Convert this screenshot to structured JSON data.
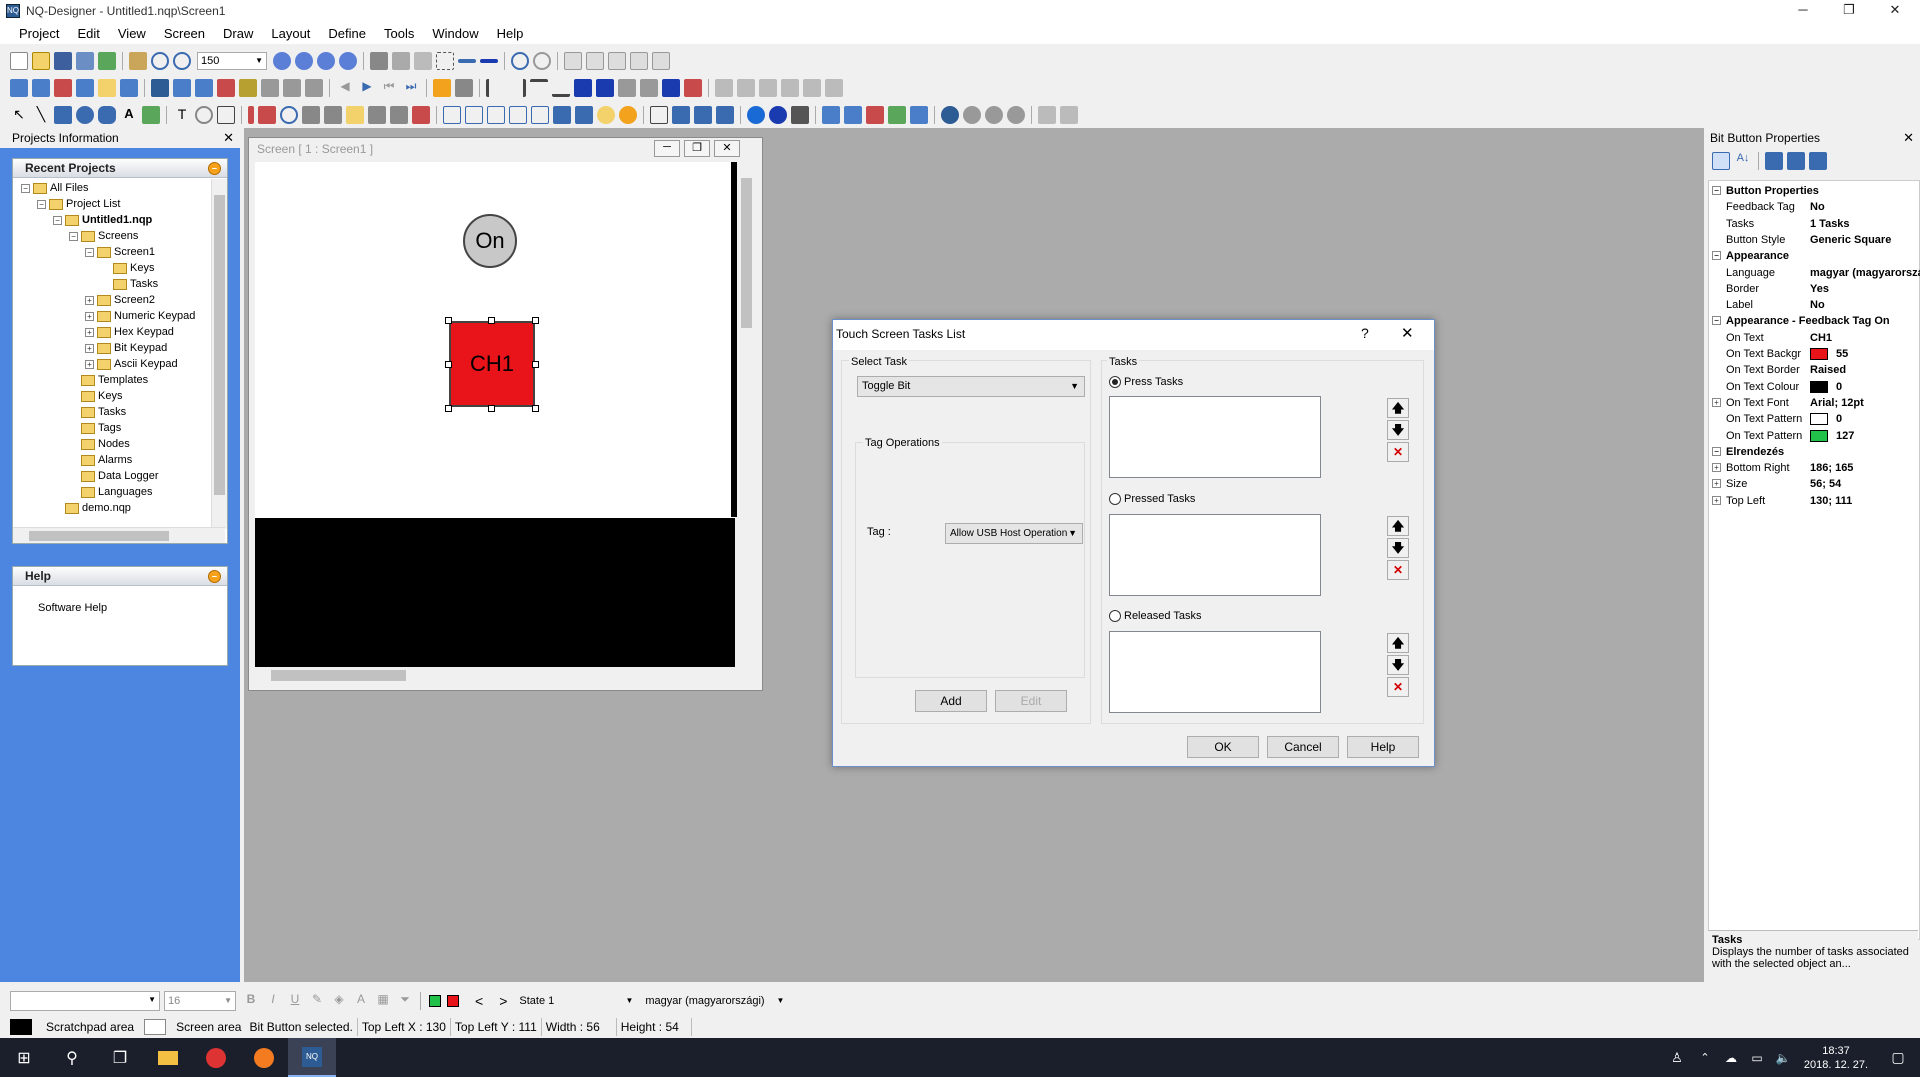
{
  "app": {
    "title": "NQ-Designer - Untitled1.nqp\\Screen1",
    "icon": "nq-app-icon",
    "window_controls": [
      "─",
      "❐",
      "✕"
    ]
  },
  "menu": [
    "Project",
    "Edit",
    "View",
    "Screen",
    "Draw",
    "Layout",
    "Define",
    "Tools",
    "Window",
    "Help"
  ],
  "toolbar1": {
    "zoom_value": "150"
  },
  "left_panel": {
    "title": "Projects Information",
    "recent_title": "Recent Projects",
    "tree": [
      {
        "label": "All Files",
        "level": 0,
        "pm": "⊟",
        "bold": false
      },
      {
        "label": "Project List",
        "level": 1,
        "pm": "⊟",
        "bold": false
      },
      {
        "label": "Untitled1.nqp",
        "level": 2,
        "pm": "⊟",
        "bold": true
      },
      {
        "label": "Screens",
        "level": 3,
        "pm": "⊟",
        "bold": false
      },
      {
        "label": "Screen1",
        "level": 4,
        "pm": "⊟",
        "bold": false
      },
      {
        "label": "Keys",
        "level": 5,
        "pm": "",
        "bold": false
      },
      {
        "label": "Tasks",
        "level": 5,
        "pm": "",
        "bold": false
      },
      {
        "label": "Screen2",
        "level": 4,
        "pm": "⊞",
        "bold": false
      },
      {
        "label": "Numeric Keypad",
        "level": 4,
        "pm": "⊞",
        "bold": false
      },
      {
        "label": "Hex Keypad",
        "level": 4,
        "pm": "⊞",
        "bold": false
      },
      {
        "label": "Bit Keypad",
        "level": 4,
        "pm": "⊞",
        "bold": false
      },
      {
        "label": "Ascii Keypad",
        "level": 4,
        "pm": "⊞",
        "bold": false
      },
      {
        "label": "Templates",
        "level": 3,
        "pm": "",
        "bold": false
      },
      {
        "label": "Keys",
        "level": 3,
        "pm": "",
        "bold": false
      },
      {
        "label": "Tasks",
        "level": 3,
        "pm": "",
        "bold": false
      },
      {
        "label": "Tags",
        "level": 3,
        "pm": "",
        "bold": false
      },
      {
        "label": "Nodes",
        "level": 3,
        "pm": "",
        "bold": false
      },
      {
        "label": "Alarms",
        "level": 3,
        "pm": "",
        "bold": false
      },
      {
        "label": "Data Logger",
        "level": 3,
        "pm": "",
        "bold": false
      },
      {
        "label": "Languages",
        "level": 3,
        "pm": "",
        "bold": false
      },
      {
        "label": "demo.nqp",
        "level": 2,
        "pm": "",
        "bold": false
      }
    ],
    "help_title": "Help",
    "help_link": "Software Help"
  },
  "screen_window": {
    "title": "Screen  [ 1 : Screen1 ]",
    "lamp_text": "On",
    "button_text": "CH1"
  },
  "dialog": {
    "title": "Touch Screen Tasks List",
    "help_glyph": "?",
    "close_glyph": "✕",
    "select_task_label": "Select Task",
    "select_task_value": "Toggle Bit",
    "tag_operations_label": "Tag Operations",
    "tag_label": "Tag :",
    "tag_value": "Allow USB Host Operation",
    "add_label": "Add",
    "edit_label": "Edit",
    "tasks_label": "Tasks",
    "press_tasks": "Press Tasks",
    "pressed_tasks": "Pressed Tasks",
    "released_tasks": "Released Tasks",
    "ok": "OK",
    "cancel": "Cancel",
    "help": "Help"
  },
  "properties": {
    "title": "Bit Button Properties",
    "rows": [
      {
        "cat": true,
        "pm": "⊟",
        "name": "Button Properties"
      },
      {
        "name": "Feedback Tag",
        "value": "No"
      },
      {
        "name": "Tasks",
        "value": "1 Tasks"
      },
      {
        "name": "Button Style",
        "value": "Generic Square"
      },
      {
        "cat": true,
        "pm": "⊟",
        "name": "Appearance"
      },
      {
        "name": "Language",
        "value": "magyar (magyarország)"
      },
      {
        "name": "Border",
        "value": "Yes"
      },
      {
        "name": "Label",
        "value": "No"
      },
      {
        "cat": true,
        "pm": "⊟",
        "name": "Appearance - Feedback Tag On"
      },
      {
        "name": "On Text",
        "value": "CH1"
      },
      {
        "name": "On Text Backgr",
        "value": "55",
        "swatch": "#e8141a"
      },
      {
        "name": "On Text Border",
        "value": "Raised"
      },
      {
        "name": "On Text Colour",
        "value": "0",
        "swatch": "#000000"
      },
      {
        "pm": "⊞",
        "name": "On Text Font",
        "value": "Arial; 12pt"
      },
      {
        "name": "On Text Pattern",
        "value": "0",
        "swatch": "#ffffff"
      },
      {
        "name": "On Text Pattern",
        "value": "127",
        "swatch": "#22c24a"
      },
      {
        "cat": true,
        "pm": "⊟",
        "name": "Elrendezés"
      },
      {
        "pm": "⊞",
        "name": "Bottom Right",
        "value": "186; 165"
      },
      {
        "pm": "⊞",
        "name": "Size",
        "value": "56; 54"
      },
      {
        "pm": "⊞",
        "name": "Top Left",
        "value": "130; 111"
      }
    ],
    "desc_title": "Tasks",
    "desc_text": "Displays the number of tasks associated with the selected object an..."
  },
  "format_bar": {
    "font_size": "16",
    "state": "State 1",
    "language": "magyar (magyarországi)"
  },
  "status_bar": [
    "Scratchpad area",
    "Screen area",
    "Bit Button selected.",
    "Top Left X : 130",
    "Top Left Y : 111",
    "Width : 56",
    "Height : 54"
  ],
  "taskbar": {
    "time": "18:37",
    "date": "2018. 12. 27."
  },
  "colors": {
    "desktop": "#4d86e0",
    "mdi": "#ababab",
    "button_red": "#e8141a",
    "taskbar": "#1a1f2b"
  }
}
